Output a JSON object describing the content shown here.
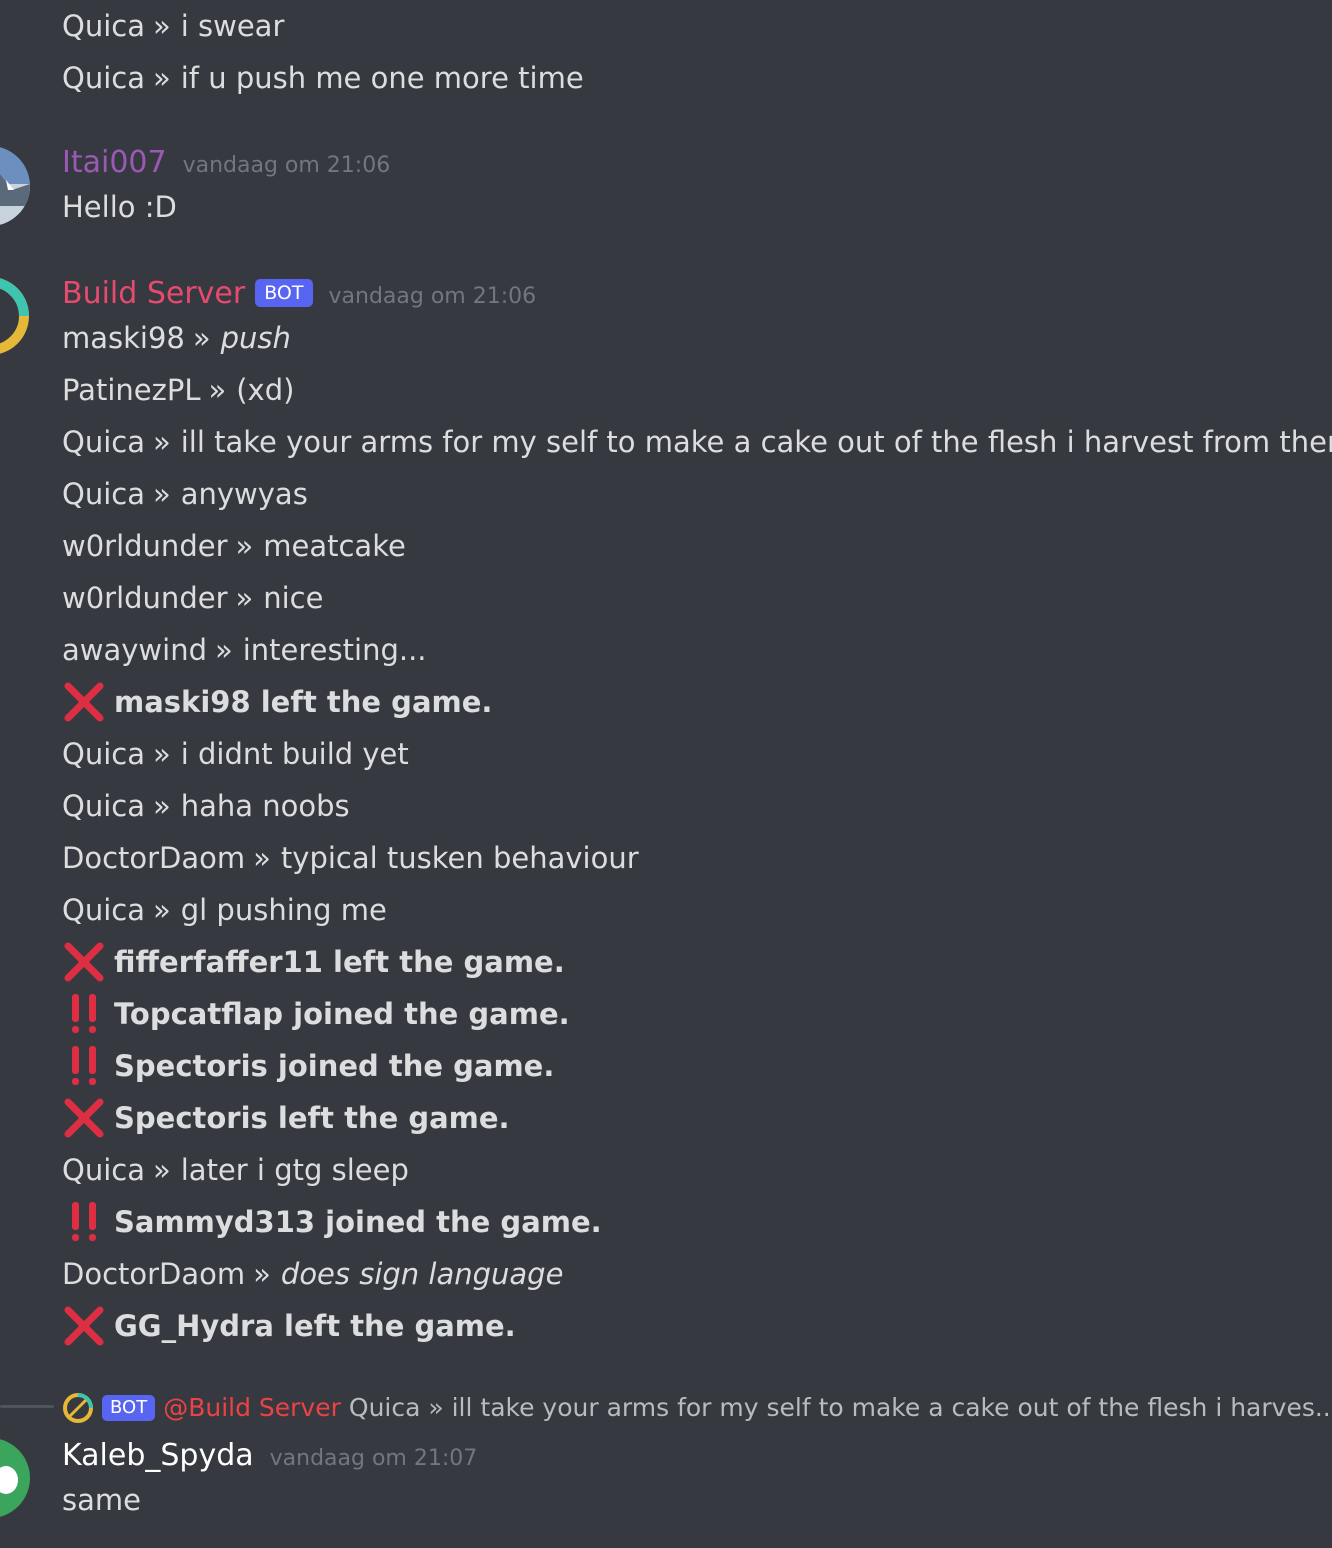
{
  "colors": {
    "background": "#36393f",
    "text": "#dcddde",
    "timestamp": "#72767d",
    "itai_name": "#9b59b6",
    "build_server_name": "#e84a6f",
    "bot_tag": "#5865f2",
    "kaleb_name": "#ffffff",
    "reply_mention": "#ed4245"
  },
  "icons": {
    "left": "cross-mark-icon",
    "joined": "double-exclamation-icon"
  },
  "top_lines": [
    {
      "author": "Quica",
      "sep": "»",
      "text": "i swear"
    },
    {
      "author": "Quica",
      "sep": "»",
      "text": "if u push me one more time"
    }
  ],
  "itai_message": {
    "username": "Itai007",
    "timestamp": "vandaag om 21:06",
    "text": "Hello :D"
  },
  "build_server_message": {
    "username": "Build Server",
    "bot_label": "BOT",
    "timestamp": "vandaag om 21:06",
    "lines": [
      {
        "author": "maski98",
        "sep": "»",
        "text": "push"
      },
      {
        "author": "PatinezPL",
        "sep": "»",
        "text": "(xd)"
      },
      {
        "author": "Quica",
        "sep": "»",
        "text": "ill take your arms for my self to make a cake out of the flesh i harvest from them"
      },
      {
        "author": "Quica",
        "sep": "»",
        "text": "anywyas"
      },
      {
        "author": "w0rldunder",
        "sep": "»",
        "text": "meatcake"
      },
      {
        "author": "w0rldunder",
        "sep": "»",
        "text": "nice"
      },
      {
        "author": "awaywind",
        "sep": "»",
        "text": "interesting..."
      },
      {
        "status_text": "maski98 left the game."
      },
      {
        "author": "Quica",
        "sep": "»",
        "text": "i didnt build yet"
      },
      {
        "author": "Quica",
        "sep": "»",
        "text": "haha noobs"
      },
      {
        "author": "DoctorDaom",
        "sep": "»",
        "text": "typical tusken behaviour"
      },
      {
        "author": "Quica",
        "sep": "»",
        "text": "gl pushing me"
      },
      {
        "status_text": "fifferfaffer11 left the game."
      },
      {
        "status_text": "Topcatflap joined the game."
      },
      {
        "status_text": "Spectoris joined the game."
      },
      {
        "status_text": "Spectoris left the game."
      },
      {
        "author": "Quica",
        "sep": "»",
        "text": "later i gtg sleep"
      },
      {
        "status_text": "Sammyd313 joined the game."
      },
      {
        "author": "DoctorDaom",
        "sep": "»",
        "text": "does sign language"
      },
      {
        "status_text": "GG_Hydra left the game."
      }
    ]
  },
  "reply": {
    "bot_label": "BOT",
    "mention": "@Build Server",
    "preview": "Quica »  ill take your arms for my self to make a cake out of the flesh i harves..."
  },
  "kaleb_message": {
    "username": "Kaleb_Spyda",
    "timestamp": "vandaag om 21:07",
    "text": "same"
  }
}
